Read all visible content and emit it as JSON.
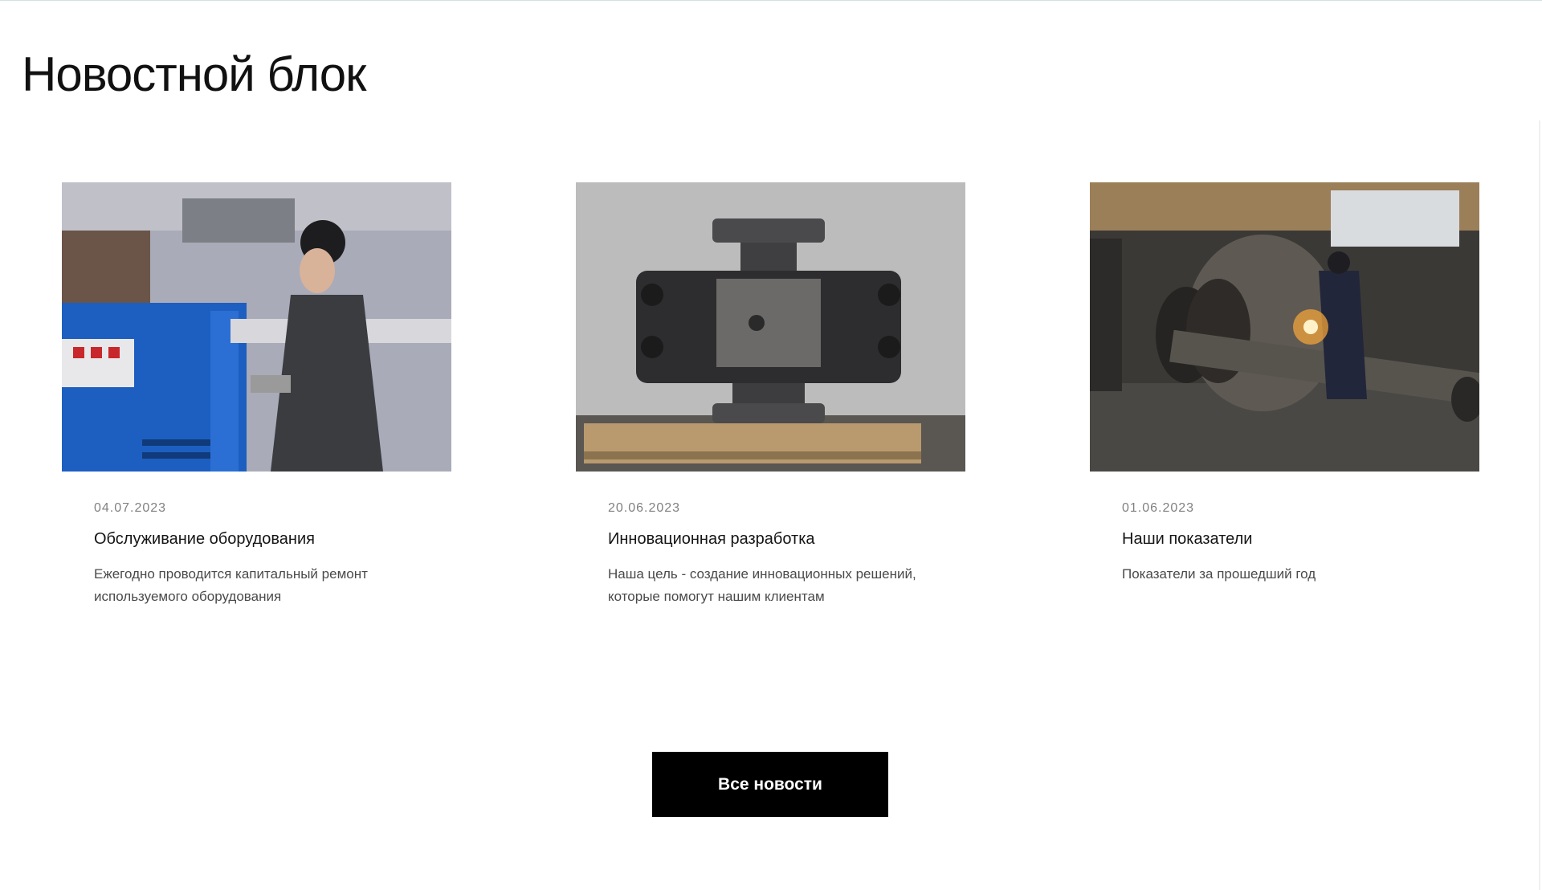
{
  "section": {
    "heading": "Новостной блок"
  },
  "news": [
    {
      "date": "04.07.2023",
      "title": "Обслуживание оборудования",
      "description": "Ежегодно проводится капитальный ремонт используемого оборудования",
      "image": "worker-servicing-blue-equipment"
    },
    {
      "date": "20.06.2023",
      "title": "Инновационная разработка",
      "description": "Наша цель - создание инновационных решений, которые помогут нашим клиентам",
      "image": "steel-valve-assembly-on-pallet"
    },
    {
      "date": "01.06.2023",
      "title": "Наши показатели",
      "description": "Показатели за прошедший год",
      "image": "welder-in-factory-workshop"
    }
  ],
  "all_news_button": {
    "label": "Все новости"
  },
  "colors": {
    "button_bg": "#000000",
    "button_text": "#ffffff",
    "date_text": "#808080",
    "accent_blue": "#1f63c4"
  }
}
